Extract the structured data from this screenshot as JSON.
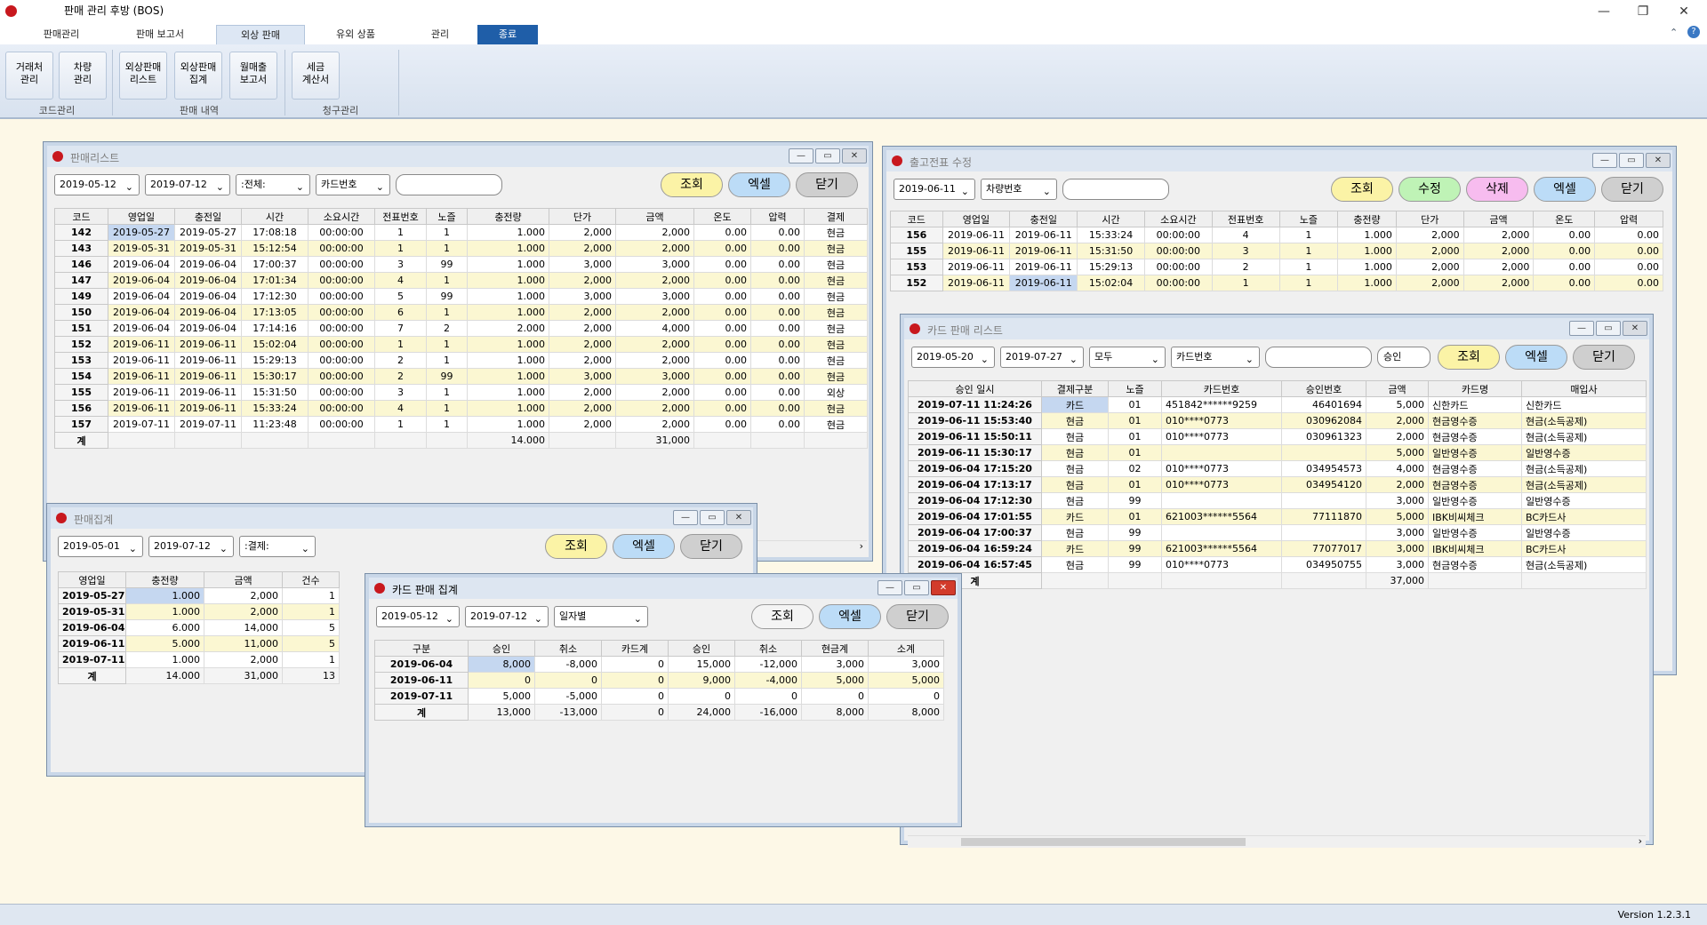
{
  "app": {
    "title": "판매 관리 후방 (BOS)",
    "version": "Version 1.2.3.1"
  },
  "tabs": [
    "판매관리",
    "판매 보고서",
    "외상 판매",
    "유외 상품",
    "관리",
    "종료"
  ],
  "ribbon": {
    "buttons": [
      "거래처\n관리",
      "차량\n관리",
      "외상판매\n리스트",
      "외상판매\n집계",
      "월매출\n보고서",
      "세금\n계산서"
    ],
    "groups": [
      "코드관리",
      "판매 내역",
      "청구관리"
    ]
  },
  "sales": {
    "title": "판매리스트",
    "date_from": "2019-05-12",
    "date_to": "2019-07-12",
    "filter": ":전체:",
    "card_filter": "카드번호",
    "search_btn": "조회",
    "excel_btn": "엑셀",
    "close_btn": "닫기",
    "headers": [
      "코드",
      "영업일",
      "충전일",
      "시간",
      "소요시간",
      "전표번호",
      "노즐",
      "충전량",
      "단가",
      "금액",
      "온도",
      "압력",
      "결제"
    ],
    "rows": [
      [
        "142",
        "2019-05-27",
        "2019-05-27",
        "17:08:18",
        "00:00:00",
        "1",
        "1",
        "1.000",
        "2,000",
        "2,000",
        "0.00",
        "0.00",
        "현금"
      ],
      [
        "143",
        "2019-05-31",
        "2019-05-31",
        "15:12:54",
        "00:00:00",
        "1",
        "1",
        "1.000",
        "2,000",
        "2,000",
        "0.00",
        "0.00",
        "현금"
      ],
      [
        "146",
        "2019-06-04",
        "2019-06-04",
        "17:00:37",
        "00:00:00",
        "3",
        "99",
        "1.000",
        "3,000",
        "3,000",
        "0.00",
        "0.00",
        "현금"
      ],
      [
        "147",
        "2019-06-04",
        "2019-06-04",
        "17:01:34",
        "00:00:00",
        "4",
        "1",
        "1.000",
        "2,000",
        "2,000",
        "0.00",
        "0.00",
        "현금"
      ],
      [
        "149",
        "2019-06-04",
        "2019-06-04",
        "17:12:30",
        "00:00:00",
        "5",
        "99",
        "1.000",
        "3,000",
        "3,000",
        "0.00",
        "0.00",
        "현금"
      ],
      [
        "150",
        "2019-06-04",
        "2019-06-04",
        "17:13:05",
        "00:00:00",
        "6",
        "1",
        "1.000",
        "2,000",
        "2,000",
        "0.00",
        "0.00",
        "현금"
      ],
      [
        "151",
        "2019-06-04",
        "2019-06-04",
        "17:14:16",
        "00:00:00",
        "7",
        "2",
        "2.000",
        "2,000",
        "4,000",
        "0.00",
        "0.00",
        "현금"
      ],
      [
        "152",
        "2019-06-11",
        "2019-06-11",
        "15:02:04",
        "00:00:00",
        "1",
        "1",
        "1.000",
        "2,000",
        "2,000",
        "0.00",
        "0.00",
        "현금"
      ],
      [
        "153",
        "2019-06-11",
        "2019-06-11",
        "15:29:13",
        "00:00:00",
        "2",
        "1",
        "1.000",
        "2,000",
        "2,000",
        "0.00",
        "0.00",
        "현금"
      ],
      [
        "154",
        "2019-06-11",
        "2019-06-11",
        "15:30:17",
        "00:00:00",
        "2",
        "99",
        "1.000",
        "3,000",
        "3,000",
        "0.00",
        "0.00",
        "현금"
      ],
      [
        "155",
        "2019-06-11",
        "2019-06-11",
        "15:31:50",
        "00:00:00",
        "3",
        "1",
        "1.000",
        "2,000",
        "2,000",
        "0.00",
        "0.00",
        "외상"
      ],
      [
        "156",
        "2019-06-11",
        "2019-06-11",
        "15:33:24",
        "00:00:00",
        "4",
        "1",
        "1.000",
        "2,000",
        "2,000",
        "0.00",
        "0.00",
        "현금"
      ],
      [
        "157",
        "2019-07-11",
        "2019-07-11",
        "11:23:48",
        "00:00:00",
        "1",
        "1",
        "1.000",
        "2,000",
        "2,000",
        "0.00",
        "0.00",
        "현금"
      ]
    ],
    "sum": [
      "계",
      "",
      "",
      "",
      "",
      "",
      "",
      "14.000",
      "",
      "31,000",
      "",
      "",
      ""
    ]
  },
  "summary": {
    "title": "판매집계",
    "date_from": "2019-05-01",
    "date_to": "2019-07-12",
    "filter": ":결제:",
    "search_btn": "조회",
    "excel_btn": "엑셀",
    "close_btn": "닫기",
    "headers": [
      "영업일",
      "충전량",
      "금액",
      "건수"
    ],
    "rows": [
      [
        "2019-05-27",
        "1.000",
        "2,000",
        "1"
      ],
      [
        "2019-05-31",
        "1.000",
        "2,000",
        "1"
      ],
      [
        "2019-06-04",
        "6.000",
        "14,000",
        "5"
      ],
      [
        "2019-06-11",
        "5.000",
        "11,000",
        "5"
      ],
      [
        "2019-07-11",
        "1.000",
        "2,000",
        "1"
      ]
    ],
    "sum": [
      "계",
      "14.000",
      "31,000",
      "13"
    ]
  },
  "card_summary": {
    "title": "카드 판매 집계",
    "date_from": "2019-05-12",
    "date_to": "2019-07-12",
    "filter": "일자별",
    "search_btn": "조회",
    "excel_btn": "엑셀",
    "close_btn": "닫기",
    "headers": [
      "구분",
      "승인",
      "취소",
      "카드계",
      "승인",
      "취소",
      "현금계",
      "소계"
    ],
    "rows": [
      [
        "2019-06-04",
        "8,000",
        "-8,000",
        "0",
        "15,000",
        "-12,000",
        "3,000",
        "3,000"
      ],
      [
        "2019-06-11",
        "0",
        "0",
        "0",
        "9,000",
        "-4,000",
        "5,000",
        "5,000"
      ],
      [
        "2019-07-11",
        "5,000",
        "-5,000",
        "0",
        "0",
        "0",
        "0",
        "0"
      ]
    ],
    "sum": [
      "계",
      "13,000",
      "-13,000",
      "0",
      "24,000",
      "-16,000",
      "8,000",
      "8,000"
    ]
  },
  "voucher": {
    "title": "출고전표 수정",
    "date": "2019-06-11",
    "filter": "차량번호",
    "search_btn": "조회",
    "edit_btn": "수정",
    "delete_btn": "삭제",
    "excel_btn": "엑셀",
    "close_btn": "닫기",
    "headers": [
      "코드",
      "영업일",
      "충전일",
      "시간",
      "소요시간",
      "전표번호",
      "노즐",
      "충전량",
      "단가",
      "금액",
      "온도",
      "압력"
    ],
    "rows": [
      [
        "156",
        "2019-06-11",
        "2019-06-11",
        "15:33:24",
        "00:00:00",
        "4",
        "1",
        "1.000",
        "2,000",
        "2,000",
        "0.00",
        "0.00"
      ],
      [
        "155",
        "2019-06-11",
        "2019-06-11",
        "15:31:50",
        "00:00:00",
        "3",
        "1",
        "1.000",
        "2,000",
        "2,000",
        "0.00",
        "0.00"
      ],
      [
        "153",
        "2019-06-11",
        "2019-06-11",
        "15:29:13",
        "00:00:00",
        "2",
        "1",
        "1.000",
        "2,000",
        "2,000",
        "0.00",
        "0.00"
      ],
      [
        "152",
        "2019-06-11",
        "2019-06-11",
        "15:02:04",
        "00:00:00",
        "1",
        "1",
        "1.000",
        "2,000",
        "2,000",
        "0.00",
        "0.00"
      ]
    ]
  },
  "card_list": {
    "title": "카드 판매 리스트",
    "date_from": "2019-05-20",
    "date_to": "2019-07-27",
    "type": "모두",
    "card_filter": "카드번호",
    "approval": "승인",
    "search_btn": "조회",
    "excel_btn": "엑셀",
    "close_btn": "닫기",
    "headers": [
      "승인 일시",
      "결제구분",
      "노즐",
      "카드번호",
      "승인번호",
      "금액",
      "카드명",
      "매입사"
    ],
    "rows": [
      [
        "2019-07-11 11:24:26",
        "카드",
        "01",
        "451842******9259",
        "46401694",
        "5,000",
        "신한카드",
        "신한카드"
      ],
      [
        "2019-06-11 15:53:40",
        "현금",
        "01",
        "010****0773",
        "030962084",
        "2,000",
        "현금영수증",
        "현금(소득공제)"
      ],
      [
        "2019-06-11 15:50:11",
        "현금",
        "01",
        "010****0773",
        "030961323",
        "2,000",
        "현금영수증",
        "현금(소득공제)"
      ],
      [
        "2019-06-11 15:30:17",
        "현금",
        "01",
        "",
        "",
        "5,000",
        "일반영수증",
        "일반영수증"
      ],
      [
        "2019-06-04 17:15:20",
        "현금",
        "02",
        "010****0773",
        "034954573",
        "4,000",
        "현금영수증",
        "현금(소득공제)"
      ],
      [
        "2019-06-04 17:13:17",
        "현금",
        "01",
        "010****0773",
        "034954120",
        "2,000",
        "현금영수증",
        "현금(소득공제)"
      ],
      [
        "2019-06-04 17:12:30",
        "현금",
        "99",
        "",
        "",
        "3,000",
        "일반영수증",
        "일반영수증"
      ],
      [
        "2019-06-04 17:01:55",
        "카드",
        "01",
        "621003******5564",
        "77111870",
        "5,000",
        "IBK비씨체크",
        "BC카드사"
      ],
      [
        "2019-06-04 17:00:37",
        "현금",
        "99",
        "",
        "",
        "3,000",
        "일반영수증",
        "일반영수증"
      ],
      [
        "2019-06-04 16:59:24",
        "카드",
        "99",
        "621003******5564",
        "77077017",
        "3,000",
        "IBK비씨체크",
        "BC카드사"
      ],
      [
        "2019-06-04 16:57:45",
        "현금",
        "99",
        "010****0773",
        "034950755",
        "3,000",
        "현금영수증",
        "현금(소득공제)"
      ]
    ],
    "sum": [
      "계",
      "",
      "",
      "",
      "",
      "37,000",
      "",
      ""
    ]
  }
}
